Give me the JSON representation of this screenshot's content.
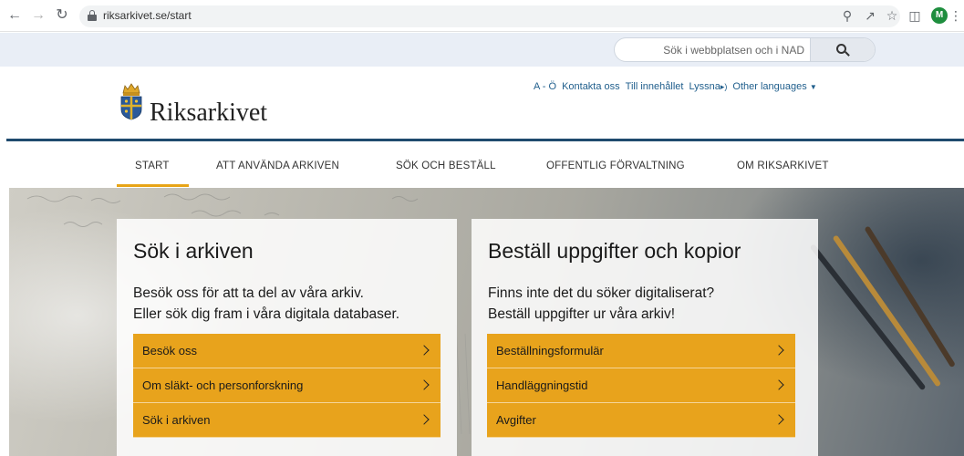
{
  "browser": {
    "url": "riksarkivet.se/start",
    "avatar_initial": "M"
  },
  "search": {
    "placeholder": "Sök i webbplatsen och i NAD"
  },
  "header": {
    "logo_text": "Riksarkivet",
    "util_links": [
      "A - Ö",
      "Kontakta oss",
      "Till innehållet",
      "Lyssna",
      "Other languages"
    ]
  },
  "nav": {
    "items": [
      "START",
      "ATT ANVÄNDA ARKIVEN",
      "SÖK OCH BESTÄLL",
      "OFFENTLIG FÖRVALTNING",
      "OM RIKSARKIVET"
    ],
    "active": "START"
  },
  "cards": [
    {
      "title": "Sök i arkiven",
      "text": [
        "Besök oss för att ta del av våra arkiv.",
        "Eller sök dig fram i våra digitala databaser."
      ],
      "links": [
        "Besök oss",
        "Om släkt- och personforskning",
        "Sök i arkiven"
      ]
    },
    {
      "title": "Beställ uppgifter och kopior",
      "text": [
        "Finns inte det du söker digitaliserat?",
        "Beställ uppgifter ur våra arkiv!"
      ],
      "links": [
        "Beställningsformulär",
        "Handläggningstid",
        "Avgifter"
      ]
    }
  ],
  "colors": {
    "accent": "#e8a31c",
    "brand_blue": "#1f4a6e",
    "link_blue": "#1f5e8c"
  }
}
